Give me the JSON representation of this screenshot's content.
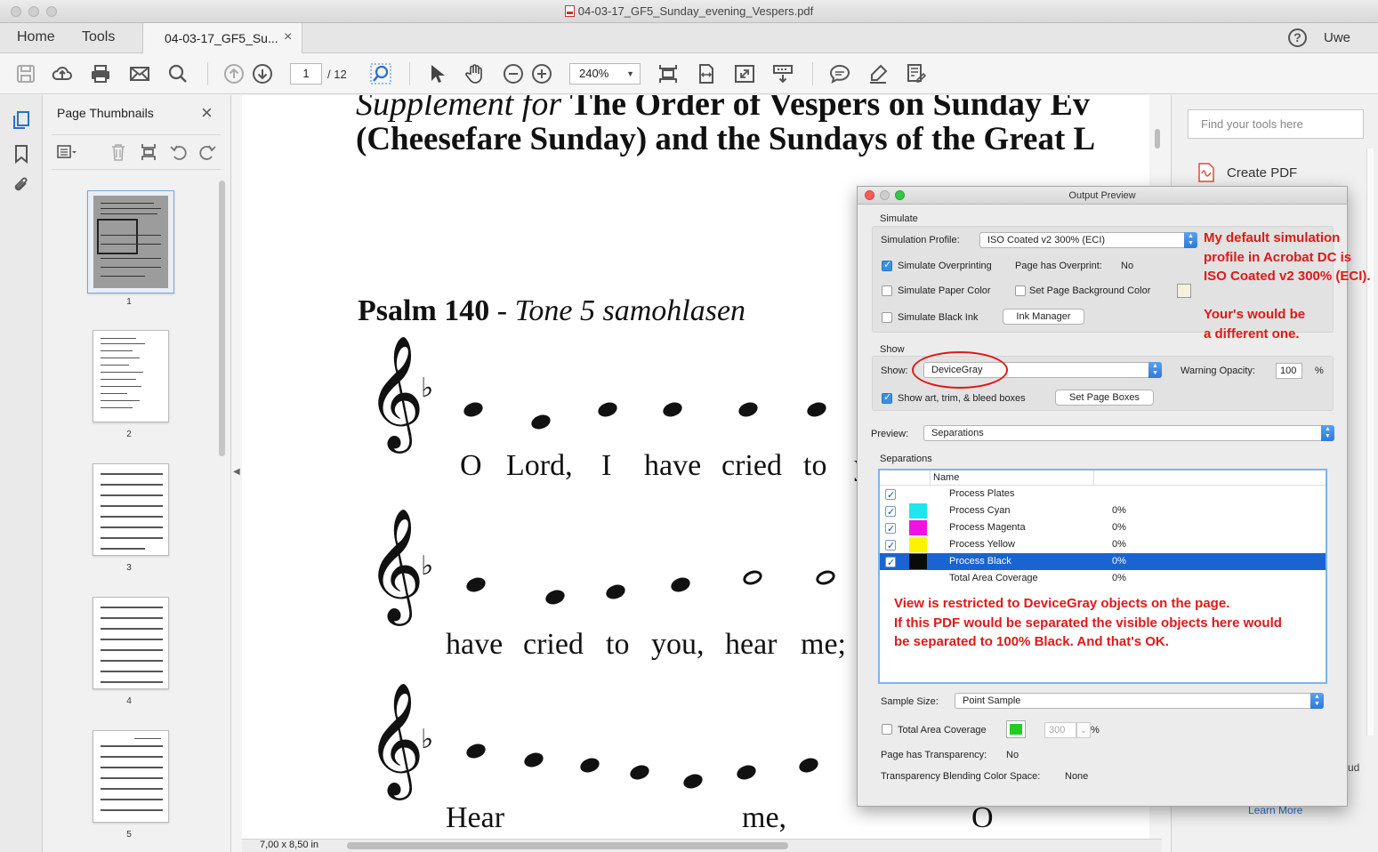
{
  "window": {
    "title": "04-03-17_GF5_Sunday_evening_Vespers.pdf"
  },
  "tabs": {
    "home": "Home",
    "tools": "Tools",
    "document": "04-03-17_GF5_Su...",
    "close": "×"
  },
  "header": {
    "help": "?",
    "user": "Uwe"
  },
  "toolbar": {
    "page_current": "1",
    "page_total": "/ 12",
    "zoom": "240%"
  },
  "thumbnails": {
    "title": "Page Thumbnails",
    "close": "×",
    "pages": [
      "1",
      "2",
      "3",
      "4",
      "5"
    ]
  },
  "document": {
    "heading_line1_italic": "Supplement for ",
    "heading_line1_bold": "The Order of Vespers on Sunday Ev",
    "heading_line2": "(Cheesefare Sunday) and the Sundays of the Great L",
    "psalm_bold": "Psalm 140",
    "psalm_dash": " - ",
    "psalm_italic": "Tone 5 samohlasen",
    "flat": "♭",
    "clef": "𝄞",
    "lyrics1": [
      "O",
      "Lord,",
      "I",
      "have",
      "cried",
      "to",
      "y"
    ],
    "lyrics2": [
      "have",
      "cried",
      "to",
      "you,",
      "hear",
      "me;"
    ],
    "lyrics3": [
      "Hear",
      "me,",
      "O"
    ],
    "page_size": "7,00 x 8,50 in"
  },
  "right_pane": {
    "find_placeholder": "Find your tools here",
    "create_pdf": "Create PDF",
    "cloud_partial": "ud",
    "learn_more": "Learn More"
  },
  "dialog": {
    "title": "Output Preview",
    "simulate": {
      "section": "Simulate",
      "profile_label": "Simulation Profile:",
      "profile_value": "ISO Coated v2 300% (ECI)",
      "overprinting_label": "Simulate Overprinting",
      "has_overprint_label": "Page has Overprint:",
      "has_overprint_value": "No",
      "paper_color_label": "Simulate Paper Color",
      "page_bg_label": "Set Page Background Color",
      "black_ink_label": "Simulate Black Ink",
      "ink_manager": "Ink Manager"
    },
    "show": {
      "section": "Show",
      "show_label": "Show:",
      "show_value": "DeviceGray",
      "warning_label": "Warning Opacity:",
      "warning_value": "100",
      "percent": "%",
      "boxes_label": "Show art, trim, & bleed boxes",
      "set_page_boxes": "Set Page Boxes"
    },
    "preview": {
      "label": "Preview:",
      "value": "Separations"
    },
    "separations": {
      "section": "Separations",
      "col_name": "Name",
      "rows": [
        {
          "name": "Process Plates",
          "pct": "",
          "color": ""
        },
        {
          "name": "Process Cyan",
          "pct": "0%",
          "color": "#1de6f0"
        },
        {
          "name": "Process Magenta",
          "pct": "0%",
          "color": "#f013e0"
        },
        {
          "name": "Process Yellow",
          "pct": "0%",
          "color": "#fff200"
        },
        {
          "name": "Process Black",
          "pct": "0%",
          "color": "#0a0a0a"
        },
        {
          "name": "Total Area Coverage",
          "pct": "0%",
          "color": ""
        }
      ]
    },
    "sample_size": {
      "label": "Sample Size:",
      "value": "Point Sample"
    },
    "total_area": {
      "label": "Total Area Coverage",
      "value": "300",
      "percent": "%",
      "swatch_color": "#22cc22"
    },
    "transparency": {
      "label": "Page has Transparency:",
      "value": "No",
      "blend_label": "Transparency Blending Color Space:",
      "blend_value": "None"
    }
  },
  "annotations": {
    "default_profile": [
      "My default simulation",
      "profile in Acrobat DC is",
      "ISO Coated v2 300% (ECI)."
    ],
    "yours": [
      "Your's would be",
      "a different one."
    ],
    "restricted": [
      "View is restricted to DeviceGray objects on the page.",
      "If this PDF would be separated the visible objects here would",
      "be separated to 100% Black. And that's OK."
    ],
    "color": "#e01818"
  }
}
